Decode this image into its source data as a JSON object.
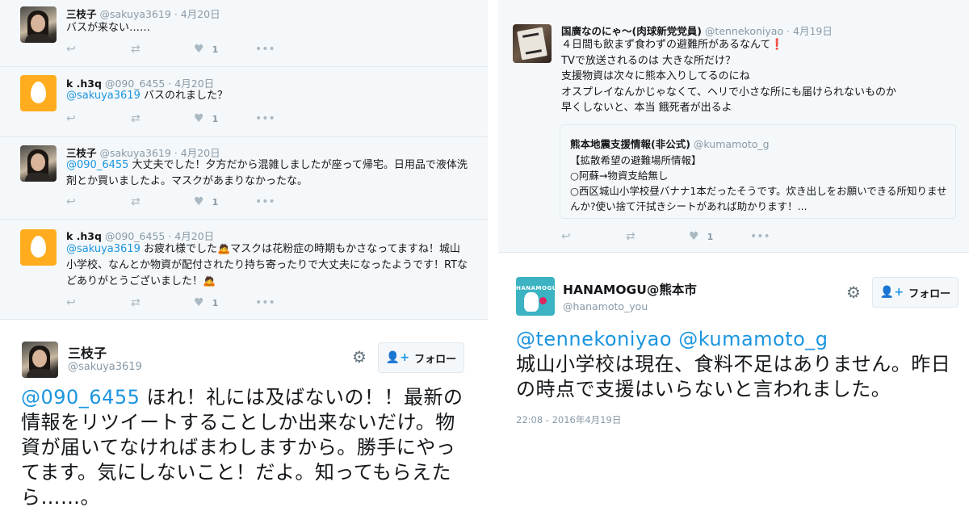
{
  "left": {
    "replies": [
      {
        "name": "三枝子",
        "handle": "@sakuya3619",
        "date": "· 4月20日",
        "avatar": "photo-avatar",
        "mention": "",
        "text": "バスが来ない……",
        "likes": "1"
      },
      {
        "name": "k .h3q",
        "handle": "@090_6455",
        "date": "· 4月20日",
        "avatar": "egg-avatar",
        "mention": "@sakuya3619",
        "text": " バスのれました？",
        "likes": "1"
      },
      {
        "name": "三枝子",
        "handle": "@sakuya3619",
        "date": "· 4月20日",
        "avatar": "photo-avatar",
        "mention": "@090_6455",
        "text": " 大丈夫でした！夕方だから混雑しましたが座って帰宅。日用品で液体洗剤とか買いましたよ。マスクがあまりなかったな。",
        "likes": "1"
      },
      {
        "name": "k .h3q",
        "handle": "@090_6455",
        "date": "· 4月20日",
        "avatar": "egg-avatar",
        "mention": "@sakuya3619",
        "text": " お疲れ様でした🙇マスクは花粉症の時期もかさなってますね！城山小学校、なんとか物資が配付されたり持ち寄ったりで大丈夫になったようです！RTなどありがとうございました！🙇",
        "likes": "1"
      }
    ],
    "main": {
      "name": "三枝子",
      "handle": "@sakuya3619",
      "follow_label": "フォロー",
      "mention": "@090_6455",
      "text": " ほれ！礼には及ばないの！！最新の情報をリツイートすることしか出来ないだけ。物資が届いてなければまわしますから。勝手にやってます。気にしないこと！だよ。知ってもらえたら……。"
    }
  },
  "right": {
    "top_tweet": {
      "name": "国廣なのにゃ〜(肉球新党党員)",
      "handle": "@tennekoniyao",
      "date": "· 4月19日",
      "text_line1": "４日間も飲まず食わずの避難所があるなんて",
      "alert_mark": "❗",
      "text_rest": "TVで放送されるのは 大きな所だけ？\n支援物資は次々に熊本入りしてるのにね\nオスプレイなんかじゃなくて、ヘリで小さな所にも届けられないものか\n早くしないと、本当 餓死者が出るよ",
      "likes": "1",
      "quote": {
        "name": "熊本地震支援情報(非公式)",
        "handle": "@kumamoto_g",
        "text": "【拡散希望の避難場所情報】\n○阿蘇→物資支給無し\n○西区城山小学校昼バナナ1本だったそうです。炊き出しをお願いできる所知りませんか?使い捨て汗拭きシートがあれば助かります！..."
      }
    },
    "main": {
      "name": "HANAMOGU@熊本市",
      "handle": "@hanamoto_you",
      "follow_label": "フォロー",
      "mention": "@tennekoniyao @kumamoto_g",
      "text": "城山小学校は現在、食料不足はありません。昨日の時点で支援はいらないと言われました。",
      "timestamp": "22:08 - 2016年4月19日",
      "avatar_logo": "HANAMOGU"
    }
  },
  "icons": {
    "reply": "reply-icon",
    "retweet": "retweet-icon",
    "like": "heart-icon",
    "more": "more-icon",
    "gear": "gear-icon",
    "follow": "follow-person-icon"
  },
  "colors": {
    "link": "#1b95e0",
    "muted": "#8899a6",
    "reply_bg": "#f5f8fa",
    "alert": "#e0245e"
  }
}
